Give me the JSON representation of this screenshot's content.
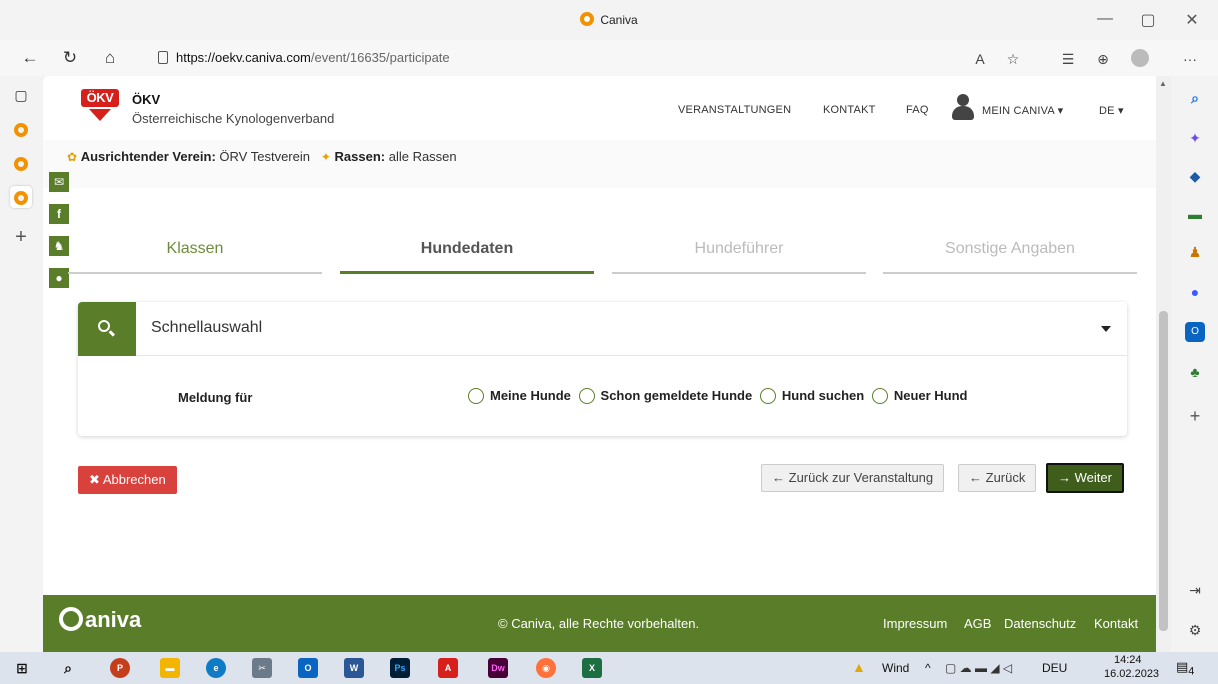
{
  "browser": {
    "window_title": "Caniva",
    "url_host": "https://oekv.caniva.com",
    "url_path": "/event/16635/participate"
  },
  "site": {
    "logo_text": "ÖKV",
    "name": "ÖKV",
    "subtitle": "Österreichische Kynologenverband",
    "nav": {
      "events": "VERANSTALTUNGEN",
      "contact": "KONTAKT",
      "faq": "FAQ",
      "account": "MEIN CANIVA",
      "lang": "DE"
    }
  },
  "event": {
    "club_label": "Ausrichtender Verein:",
    "club_value": "ÖRV Testverein",
    "breeds_label": "Rassen:",
    "breeds_value": "alle Rassen"
  },
  "steps": [
    {
      "label": "Klassen",
      "state": "done"
    },
    {
      "label": "Hundedaten",
      "state": "active"
    },
    {
      "label": "Hundeführer",
      "state": "todo"
    },
    {
      "label": "Sonstige Angaben",
      "state": "todo"
    }
  ],
  "quick_select": {
    "label": "Schnellauswahl"
  },
  "registration": {
    "label": "Meldung für",
    "options": [
      "Meine Hunde",
      "Schon gemeldete Hunde",
      "Hund suchen",
      "Neuer Hund"
    ]
  },
  "actions": {
    "cancel": "Abbrechen",
    "back_to_event": "Zurück zur Veranstaltung",
    "back": "Zurück",
    "next": "Weiter"
  },
  "footer": {
    "brand": "aniva",
    "copyright": "© Caniva, alle Rechte vorbehalten.",
    "links": [
      "Impressum",
      "AGB",
      "Datenschutz",
      "Kontakt"
    ]
  },
  "taskbar": {
    "weather": "Wind",
    "lang": "DEU",
    "time": "14:24",
    "date": "16.02.2023",
    "notifications": "4"
  },
  "colors": {
    "brand_green": "#5a7d2a",
    "cancel_red": "#d9413d",
    "okv_red": "#d7201c",
    "caniva_orange": "#f39200"
  }
}
